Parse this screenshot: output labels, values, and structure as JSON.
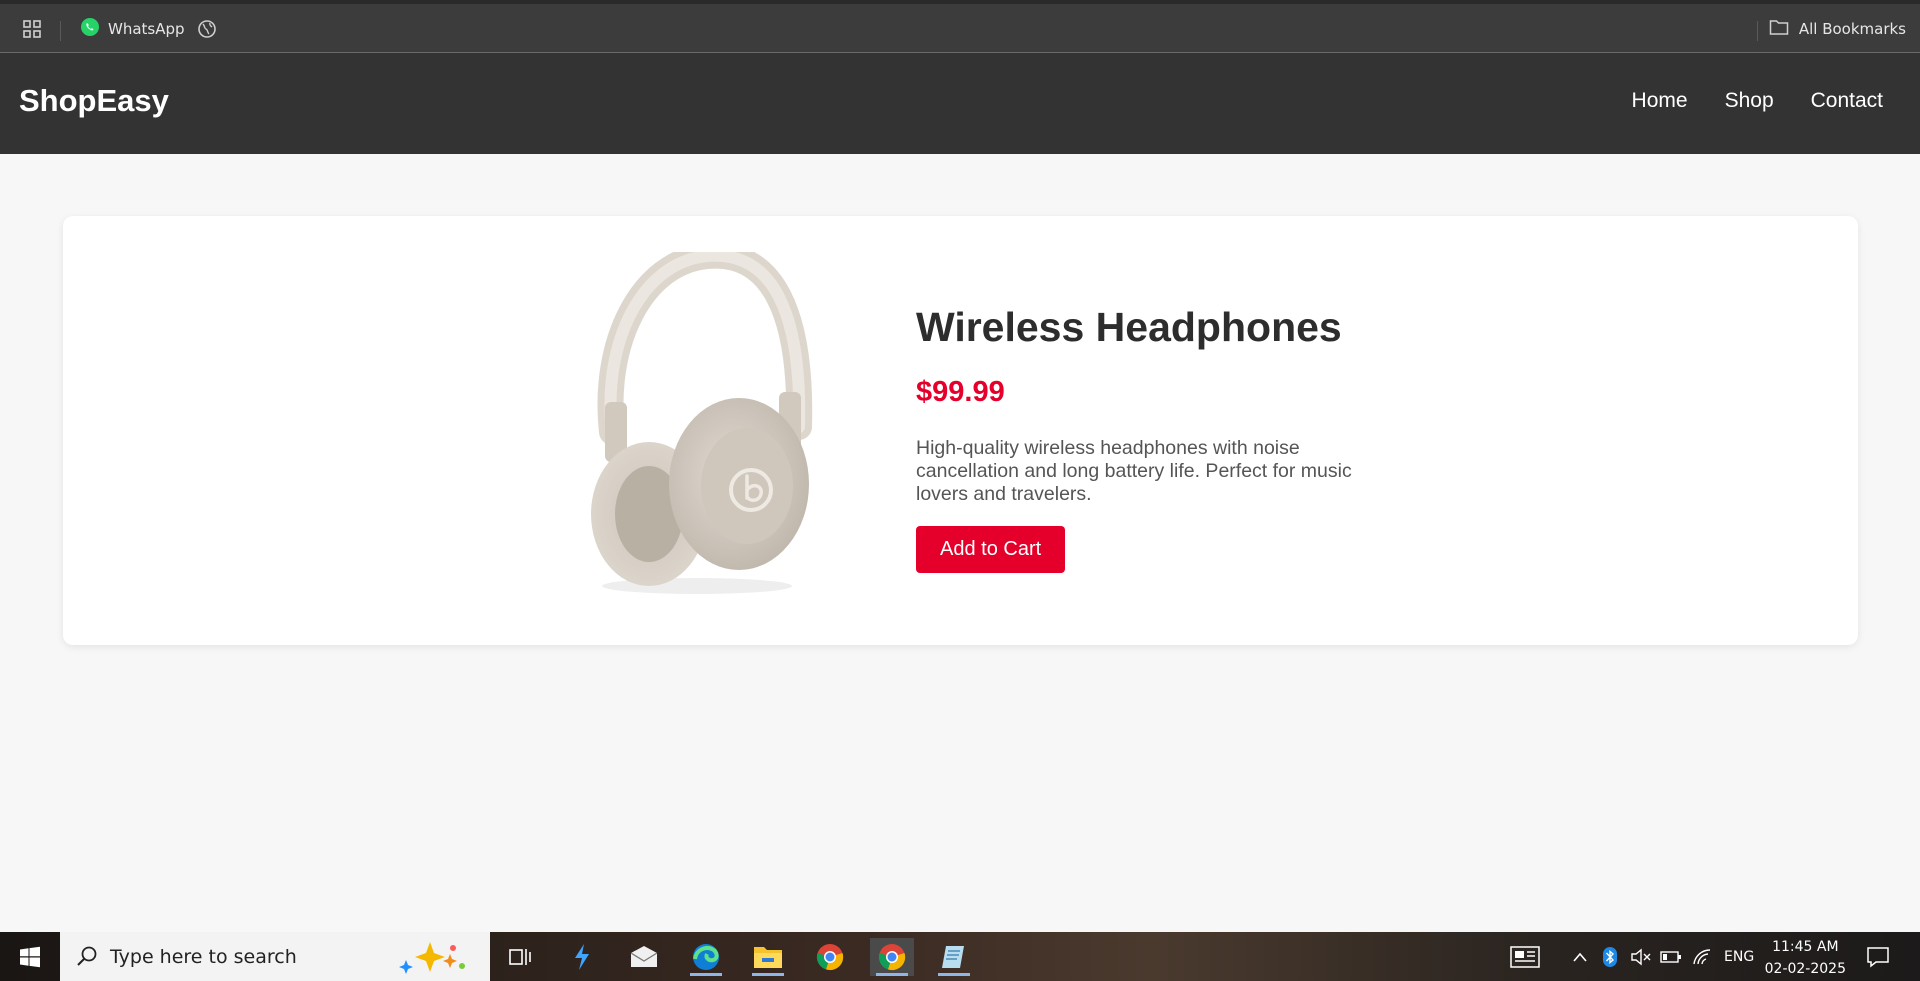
{
  "bookmarks": {
    "whatsapp_label": "WhatsApp",
    "all_bookmarks_label": "All Bookmarks"
  },
  "site": {
    "brand": "ShopEasy",
    "nav": [
      {
        "label": "Home"
      },
      {
        "label": "Shop"
      },
      {
        "label": "Contact"
      }
    ]
  },
  "product": {
    "title": "Wireless Headphones",
    "price": "$99.99",
    "description": "High-quality wireless headphones with noise cancellation and long battery life. Perfect for music lovers and travelers.",
    "add_to_cart_label": "Add to Cart"
  },
  "taskbar": {
    "search_placeholder": "Type here to search",
    "language": "ENG",
    "time": "11:45 AM",
    "date": "02-02-2025"
  },
  "colors": {
    "header_bg": "#333333",
    "accent": "#e4002b",
    "page_bg": "#f7f7f7"
  }
}
